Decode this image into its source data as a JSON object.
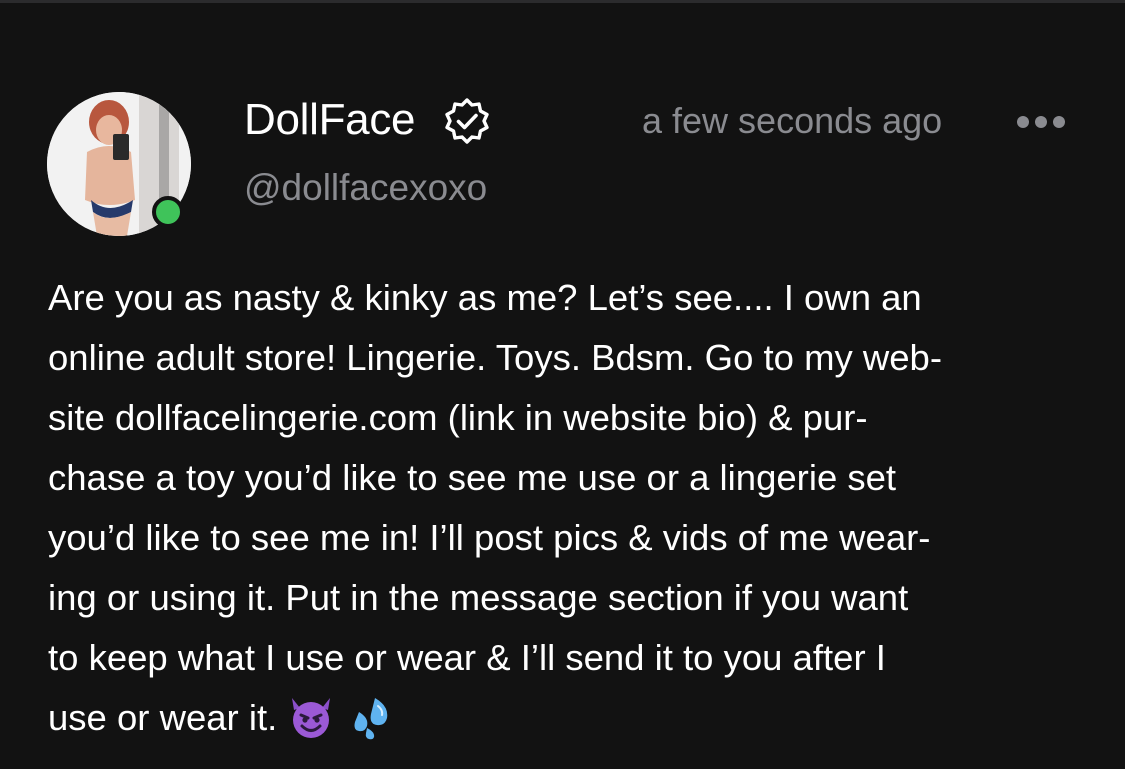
{
  "post": {
    "author": {
      "display_name": "DollFace",
      "handle": "@dollfacexoxo",
      "verified": true,
      "online": true,
      "online_color": "#3fc35a"
    },
    "timestamp": "a few seconds ago",
    "more_icon": "ellipsis-icon",
    "body_lines": [
      "Are you as nasty & kinky as me? Let’s see.... I own an",
      "online adult store! Lingerie. Toys. Bdsm. Go to my web-",
      "site dollfacelingerie.com (link in website bio) & pur-",
      "chase a toy you’d like to see me use or a lingerie set",
      "you’d like to see me in! I’ll post pics & vids of me wear-",
      "ing or using it. Put in the message section if you want",
      "to keep what I use or wear & I’ll send it to you after I",
      "use or wear it."
    ],
    "emojis": [
      "smiling-imp-emoji",
      "sweat-droplets-emoji"
    ]
  },
  "theme": {
    "background": "#121212",
    "text": "#ffffff",
    "muted_text": "#8a8b90"
  }
}
